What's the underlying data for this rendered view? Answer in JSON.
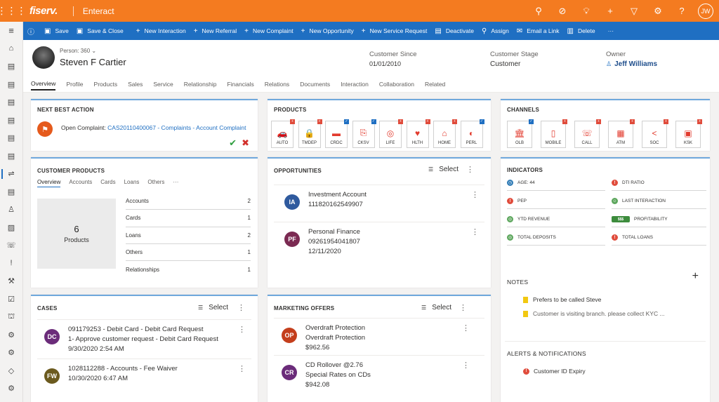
{
  "topbar": {
    "logo": "fiserv.",
    "app": "Enteract",
    "user_initials": "JW"
  },
  "commands": [
    {
      "icon": "▣",
      "label": "Save"
    },
    {
      "icon": "▣",
      "label": "Save & Close"
    },
    {
      "icon": "+",
      "label": "New Interaction"
    },
    {
      "icon": "+",
      "label": "New Referral"
    },
    {
      "icon": "+",
      "label": "New Complaint"
    },
    {
      "icon": "+",
      "label": "New Opportunity"
    },
    {
      "icon": "+",
      "label": "New Service Request"
    },
    {
      "icon": "▤",
      "label": "Deactivate"
    },
    {
      "icon": "⚲",
      "label": "Assign"
    },
    {
      "icon": "✉",
      "label": "Email a Link"
    },
    {
      "icon": "▥",
      "label": "Delete"
    }
  ],
  "more": "···",
  "person": {
    "type": "Person: 360",
    "name": "Steven F Cartier"
  },
  "header": {
    "since_label": "Customer Since",
    "since_value": "01/01/2010",
    "stage_label": "Customer Stage",
    "stage_value": "Customer",
    "owner_label": "Owner",
    "owner_value": "Jeff Williams"
  },
  "tabs": [
    "Overview",
    "Profile",
    "Products",
    "Sales",
    "Service",
    "Relationship",
    "Financials",
    "Relations",
    "Documents",
    "Interaction",
    "Collaboration",
    "Related"
  ],
  "nba": {
    "title": "NEXT BEST ACTION",
    "prefix": "Open Complaint: ",
    "link": "CAS20110400067 - Complaints - Account Complaint"
  },
  "products": {
    "title": "PRODUCTS",
    "items": [
      {
        "icon": "🚗",
        "label": "AUTO",
        "corner": "+"
      },
      {
        "icon": "🔒",
        "label": "TMDEP",
        "corner": "+"
      },
      {
        "icon": "▬",
        "label": "CRDC",
        "corner": "✓"
      },
      {
        "icon": "⎘",
        "label": "CKSV",
        "corner": "✓"
      },
      {
        "icon": "◎",
        "label": "LIFE",
        "corner": "+"
      },
      {
        "icon": "♥",
        "label": "HLTH",
        "corner": "+"
      },
      {
        "icon": "⌂",
        "label": "HOME",
        "corner": "+"
      },
      {
        "icon": "◐",
        "label": "PERL",
        "corner": "✓"
      }
    ]
  },
  "channels": {
    "title": "CHANNELS",
    "items": [
      {
        "icon": "🏛",
        "label": "OLB",
        "corner": "✓"
      },
      {
        "icon": "▯",
        "label": "MOBILE",
        "corner": "+"
      },
      {
        "icon": "☏",
        "label": "CALL",
        "corner": "+"
      },
      {
        "icon": "▦",
        "label": "ATM",
        "corner": "+"
      },
      {
        "icon": "<",
        "label": "SOC",
        "corner": "+"
      },
      {
        "icon": "▣",
        "label": "KSK",
        "corner": "+"
      }
    ]
  },
  "customer_products": {
    "title": "CUSTOMER PRODUCTS",
    "subtabs": [
      "Overview",
      "Accounts",
      "Cards",
      "Loans",
      "Others",
      "···"
    ],
    "total": "6",
    "total_label": "Products",
    "rows": [
      {
        "label": "Accounts",
        "value": "2"
      },
      {
        "label": "Cards",
        "value": "1"
      },
      {
        "label": "Loans",
        "value": "2"
      },
      {
        "label": "Others",
        "value": "1"
      },
      {
        "label": "Relationships",
        "value": "1"
      }
    ]
  },
  "opportunities": {
    "title": "OPPORTUNITIES",
    "select": "Select",
    "items": [
      {
        "initials": "IA",
        "color": "#2f5a9e",
        "l1": "Investment Account",
        "l2": "111820162549907",
        "l3": ""
      },
      {
        "initials": "PF",
        "color": "#7b2a52",
        "l1": "Personal Finance",
        "l2": "09261954041807",
        "l3": "12/11/2020"
      }
    ]
  },
  "indicators": {
    "title": "INDICATORS",
    "items": [
      {
        "label": "AGE: 44",
        "color": "#2f7bb5",
        "sym": "◷"
      },
      {
        "label": "DTI RATIO",
        "color": "#e04c3c",
        "sym": "!"
      },
      {
        "label": "PEP",
        "color": "#e04c3c",
        "sym": "!"
      },
      {
        "label": "LAST INTERACTION",
        "color": "#5ca65c",
        "sym": "☺"
      },
      {
        "label": "YTD REVENUE",
        "color": "#5ca65c",
        "sym": "◎"
      },
      {
        "label": "PROFITABILITY",
        "color": "#3d8c3d",
        "sym": "$$$"
      },
      {
        "label": "TOTAL DEPOSITS",
        "color": "#5ca65c",
        "sym": "◎"
      },
      {
        "label": "TOTAL LOANS",
        "color": "#e04c3c",
        "sym": "!"
      }
    ]
  },
  "notes": {
    "title": "NOTES",
    "items": [
      "Prefers to be called Steve",
      "Customer is visiting branch. please collect KYC ..."
    ]
  },
  "alerts": {
    "title": "ALERTS & NOTIFICATIONS",
    "items": [
      "Customer ID Expiry"
    ]
  },
  "cases": {
    "title": "CASES",
    "select": "Select",
    "items": [
      {
        "initials": "DC",
        "color": "#6b2c7a",
        "l1": "091179253 - Debit Card - Debit Card Request",
        "l2": "1- Approve customer request - Debit Card Request",
        "l3": "9/30/2020 2:54 AM"
      },
      {
        "initials": "FW",
        "color": "#6b5a1e",
        "l1": "1028112288 - Accounts - Fee Waiver",
        "l2": "10/30/2020 6:47 AM",
        "l3": ""
      }
    ]
  },
  "offers": {
    "title": "MARKETING OFFERS",
    "select": "Select",
    "items": [
      {
        "initials": "OP",
        "color": "#c43e1c",
        "l1": "Overdraft Protection",
        "l2": "Overdraft Protection",
        "l3": "$962.56"
      },
      {
        "initials": "CR",
        "color": "#6b2c7a",
        "l1": "CD Rollover @2.76",
        "l2": "Special Rates on CDs",
        "l3": "$942.08"
      }
    ]
  }
}
